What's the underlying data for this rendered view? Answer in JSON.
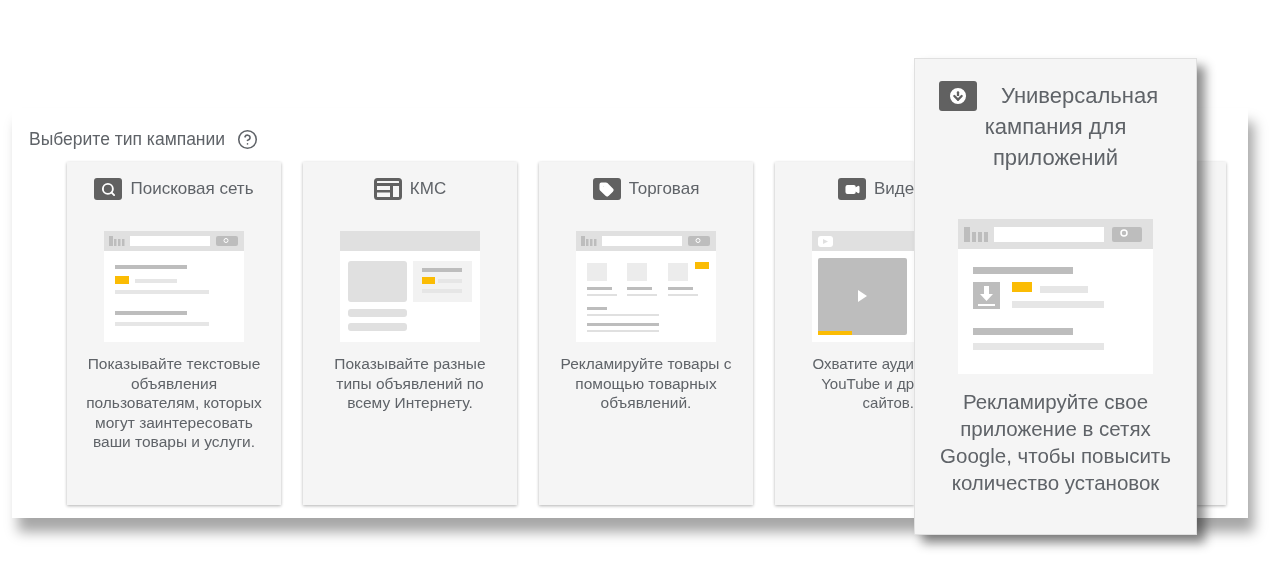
{
  "header": {
    "title": "Выберите тип кампании"
  },
  "campaign_types": [
    {
      "kind": "search",
      "title": "Поисковая сеть",
      "description": "Показывайте текстовые объявления пользователям, которых могут заинтересовать ваши товары и услуги."
    },
    {
      "kind": "display",
      "title": "КМС",
      "description": "Показывайте разные типы объявлений по всему Интернету."
    },
    {
      "kind": "shopping",
      "title": "Торговая",
      "description": "Рекламируйте товары с помощью товарных объявлений."
    },
    {
      "kind": "video",
      "title": "Виде",
      "description": "Охватите ауди\nYouTube и др\nсайтов."
    },
    {
      "kind": "covered"
    }
  ],
  "highlighted_card": {
    "kind": "app",
    "title": "Универсальная кампания для приложений",
    "description": "Рекламируйте свое приложение в сетях Google, чтобы повысить количество установок"
  }
}
